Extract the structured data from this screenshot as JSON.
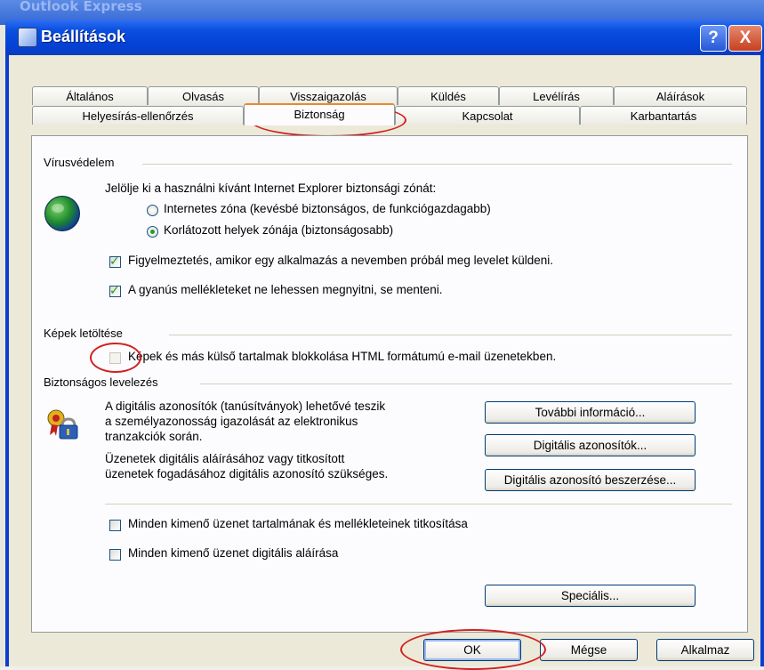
{
  "background_app": {
    "title": "Outlook Express"
  },
  "window": {
    "title": "Beállítások",
    "help_label": "?",
    "close_label": "X"
  },
  "tabs_row1": [
    {
      "label": "Általános"
    },
    {
      "label": "Olvasás"
    },
    {
      "label": "Visszaigazolás"
    },
    {
      "label": "Küldés"
    },
    {
      "label": "Levélírás"
    },
    {
      "label": "Aláírások"
    }
  ],
  "tabs_row2": [
    {
      "label": "Helyesírás-ellenőrzés"
    },
    {
      "label": "Biztonság",
      "selected": true
    },
    {
      "label": "Kapcsolat"
    },
    {
      "label": "Karbantartás"
    }
  ],
  "virus": {
    "group_label": "Vírusvédelem",
    "zone_prompt": "Jelölje ki a használni kívánt Internet Explorer biztonsági zónát:",
    "radio_internet": "Internetes zóna (kevésbé biztonságos, de funkciógazdagabb)",
    "radio_restricted": "Korlátozott helyek zónája (biztonságosabb)",
    "selected_zone": "restricted",
    "check_warn": "Figyelmeztetés, amikor egy alkalmazás a nevemben próbál meg levelet küldeni.",
    "check_warn_checked": true,
    "check_attach": "A gyanús mellékleteket ne lehessen megnyitni, se menteni.",
    "check_attach_checked": true
  },
  "images": {
    "group_label": "Képek letöltése",
    "check_block": "Képek és más külső tartalmak blokkolása HTML formátumú e-mail üzenetekben.",
    "check_block_checked": false
  },
  "secure": {
    "group_label": "Biztonságos levelezés",
    "text1_line1": "A digitális azonosítók (tanúsítványok) lehetővé teszik",
    "text1_line2": "a személyazonosság igazolását az elektronikus",
    "text1_line3": "tranzakciók során.",
    "text2_line1": "Üzenetek digitális aláírásához vagy titkosított",
    "text2_line2": "üzenetek fogadásához digitális azonosító szükséges.",
    "btn_more_info": "További információ...",
    "btn_digital_ids": "Digitális azonosítók...",
    "btn_get_id": "Digitális azonosító beszerzése...",
    "check_encrypt": "Minden kimenő üzenet tartalmának és mellékleteinek titkosítása",
    "check_encrypt_checked": false,
    "check_sign": "Minden kimenő üzenet digitális aláírása",
    "check_sign_checked": false,
    "btn_advanced": "Speciális..."
  },
  "footer": {
    "ok": "OK",
    "cancel": "Mégse",
    "apply": "Alkalmaz"
  },
  "colors": {
    "titlebar": "#0342d6",
    "annotation_oval": "#d02020",
    "check_green": "#21a121"
  }
}
